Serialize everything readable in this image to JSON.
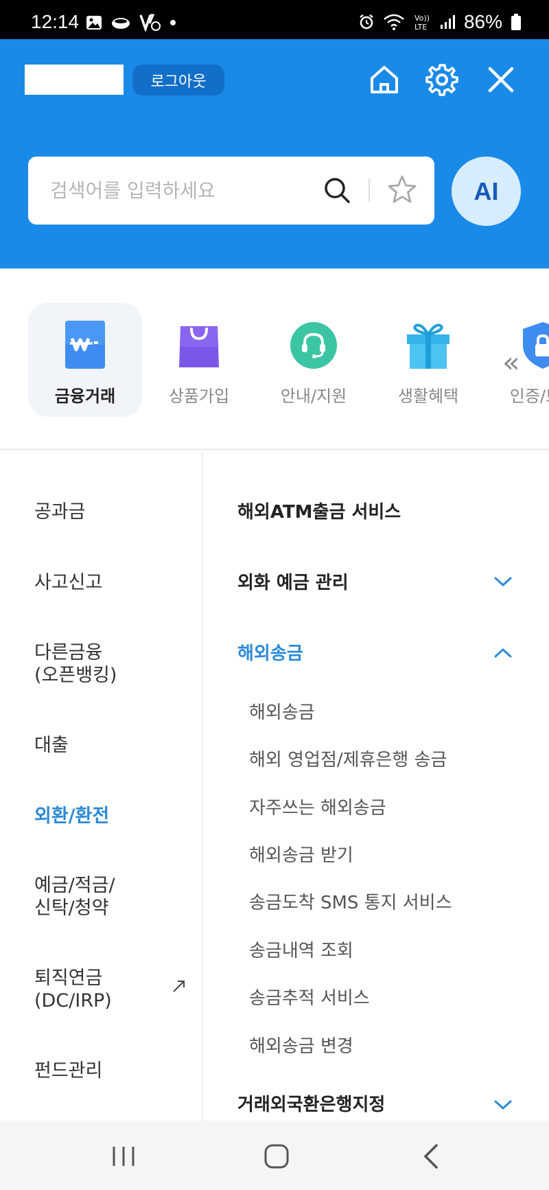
{
  "status_bar": {
    "time": "12:14",
    "battery": "86%"
  },
  "header": {
    "logout_label": "로그아웃"
  },
  "search": {
    "placeholder": "검색어를 입력하세요",
    "ai_label": "AI"
  },
  "categories": [
    {
      "label": "금융거래",
      "icon": "won-card-icon",
      "active": true
    },
    {
      "label": "상품가입",
      "icon": "shopping-bag-icon",
      "active": false
    },
    {
      "label": "안내/지원",
      "icon": "headset-icon",
      "active": false
    },
    {
      "label": "생활혜택",
      "icon": "gift-icon",
      "active": false
    },
    {
      "label": "인증/보안",
      "icon": "shield-lock-icon",
      "active": false
    }
  ],
  "left_menu": [
    {
      "label": "공과금"
    },
    {
      "label": "사고신고"
    },
    {
      "label": "다른금융\n(오픈뱅킹)"
    },
    {
      "label": "대출"
    },
    {
      "label": "외환/환전",
      "active": true
    },
    {
      "label": "예금/적금/\n신탁/청약"
    },
    {
      "label": "퇴직연금\n(DC/IRP)",
      "external": true
    },
    {
      "label": "펀드관리"
    }
  ],
  "right_menu": {
    "items": [
      {
        "label": "해외ATM출금 서비스"
      },
      {
        "label": "외화 예금 관리",
        "expandable": true
      },
      {
        "label": "해외송금",
        "expanded": true,
        "active": true
      },
      {
        "label": "거래외국환은행지정",
        "expandable": true
      }
    ],
    "sub_items": [
      "해외송금",
      "해외 영업점/제휴은행 송금",
      "자주쓰는 해외송금",
      "해외송금 받기",
      "송금도착 SMS 통지 서비스",
      "송금내역 조회",
      "송금추적 서비스",
      "해외송금 변경"
    ]
  },
  "colors": {
    "header_blue": "#1a8ae8",
    "accent_blue": "#2a8ad8",
    "logout_bg": "#126fc8"
  }
}
